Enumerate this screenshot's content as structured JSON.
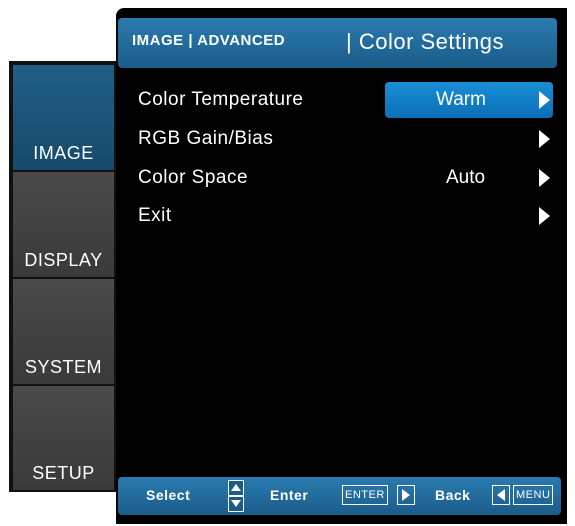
{
  "header": {
    "breadcrumb": "IMAGE | ADVANCED",
    "title": "| Color Settings"
  },
  "sidebar": {
    "items": [
      {
        "label": "IMAGE",
        "active": true
      },
      {
        "label": "DISPLAY",
        "active": false
      },
      {
        "label": "SYSTEM",
        "active": false
      },
      {
        "label": "SETUP",
        "active": false
      }
    ]
  },
  "menu": {
    "rows": [
      {
        "label": "Color Temperature",
        "value": "Warm",
        "icon": "arrow-right-icon"
      },
      {
        "label": "RGB Gain/Bias",
        "value": "",
        "icon": "arrow-right-icon"
      },
      {
        "label": "Color Space",
        "value": "Auto",
        "icon": "arrow-right-icon"
      },
      {
        "label": "Exit",
        "value": "",
        "icon": "arrow-right-icon"
      }
    ]
  },
  "footer": {
    "select_label": "Select",
    "enter_label": "Enter",
    "enter_key": "ENTER",
    "back_label": "Back",
    "menu_key": "MENU"
  },
  "colors": {
    "accent": "#1a8fd6",
    "header": "#2a7bb0",
    "active_tab": "#1f5f86",
    "inactive_tab": "#444444",
    "panel": "#000000"
  }
}
